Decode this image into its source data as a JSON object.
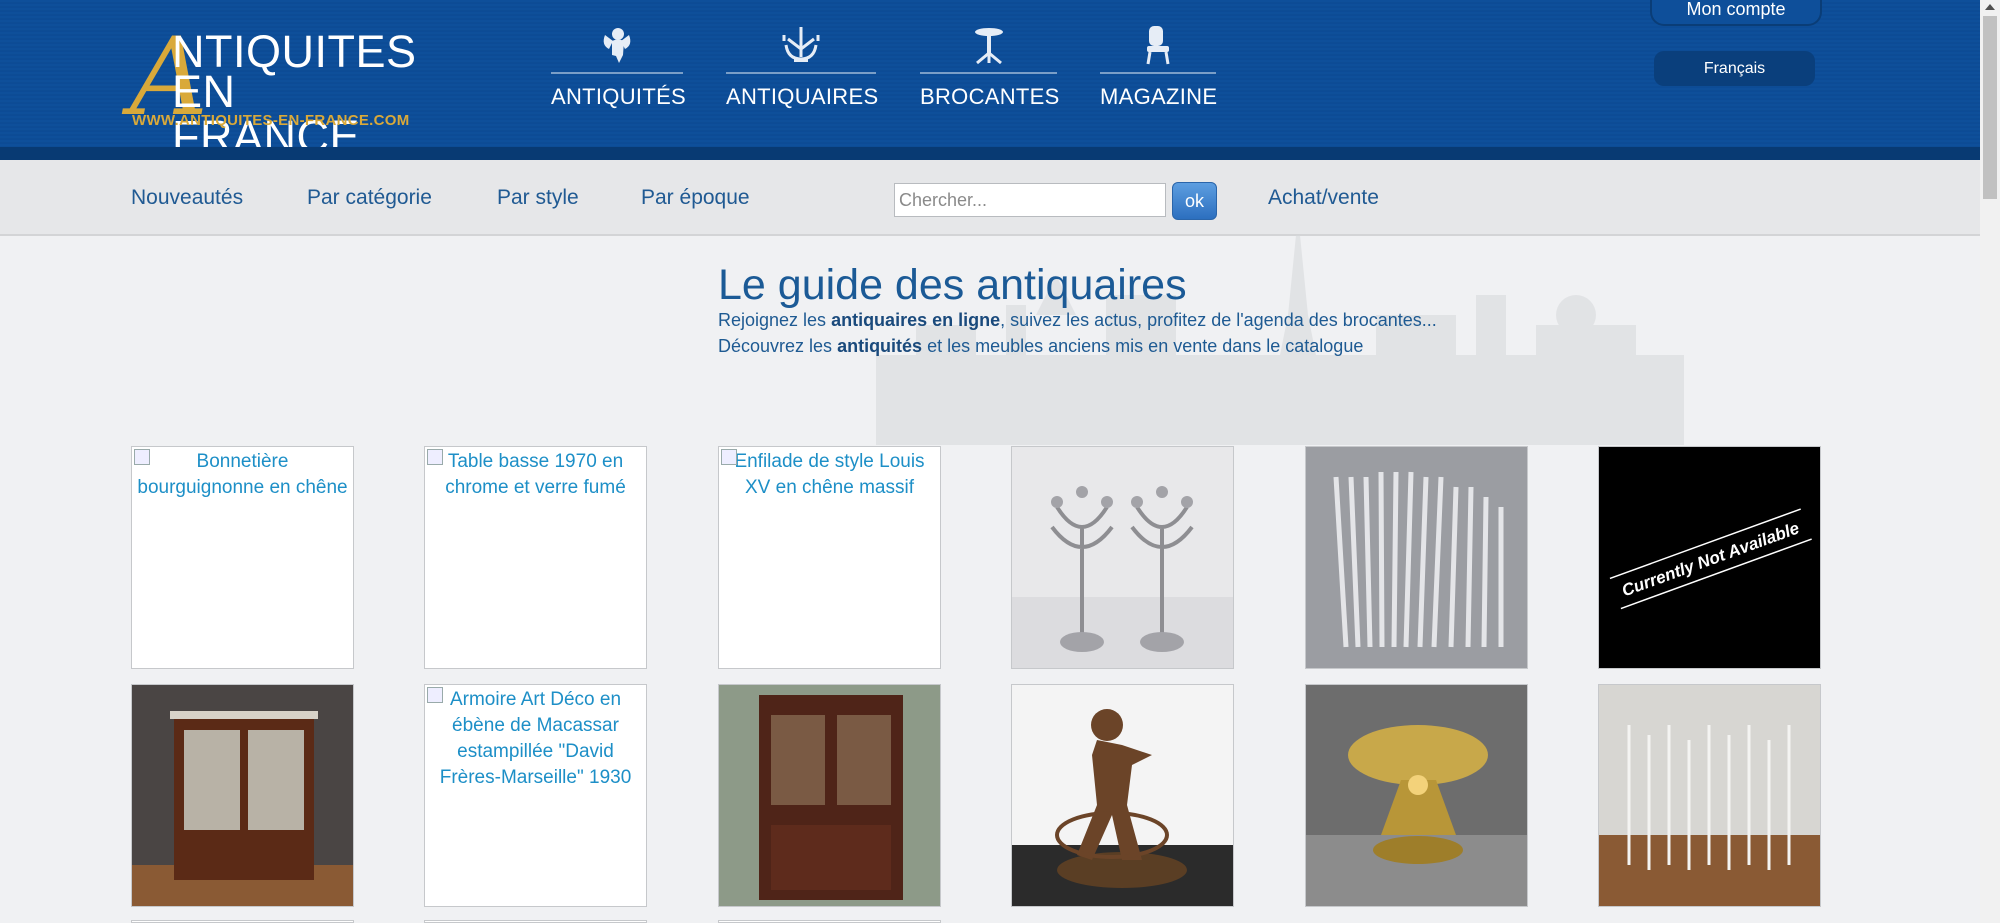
{
  "logo": {
    "line1": "NTIQUITES",
    "line2": "EN FRANCE",
    "big_letter": "A",
    "url": "WWW.ANTIQUITES-EN-FRANCE.COM"
  },
  "main_nav": [
    {
      "label": "ANTIQUITÉS",
      "icon": "cherub-icon"
    },
    {
      "label": "ANTIQUAIRES",
      "icon": "candelabra-icon"
    },
    {
      "label": "BROCANTES",
      "icon": "table-icon"
    },
    {
      "label": "MAGAZINE",
      "icon": "chair-icon"
    }
  ],
  "account": {
    "label": "Mon compte"
  },
  "language": {
    "label": "Français"
  },
  "subnav": {
    "items": [
      "Nouveautés",
      "Par catégorie",
      "Par style",
      "Par époque"
    ],
    "search_placeholder": "Chercher...",
    "search_button": "ok",
    "achat": "Achat/vente"
  },
  "intro": {
    "title": "Le guide des antiquaires",
    "line1_pre": "Rejoignez les ",
    "line1_bold": "antiquaires en ligne",
    "line1_post": ", suivez les actus, profitez de l'agenda des brocantes...",
    "line2_pre": "Découvrez les ",
    "line2_bold": "antiquités",
    "line2_post": " et les meubles anciens mis en vente dans le catalogue"
  },
  "products": [
    {
      "alt": "Bonnetière bourguignonne en chêne",
      "broken": true
    },
    {
      "alt": "Table basse 1970 en chrome et verre fumé",
      "broken": true
    },
    {
      "alt": "Enfilade de style Louis XV en chêne massif",
      "broken": true
    },
    {
      "alt": "Paire de candélabres en argent",
      "broken": false,
      "picture": "candelabra-photo"
    },
    {
      "alt": "Ménagère en argent",
      "broken": false,
      "picture": "cutlery-photo"
    },
    {
      "alt": "Currently Not Available",
      "broken": false,
      "picture": "not-available-photo"
    },
    {
      "alt": "Vitrine en acajou",
      "broken": false,
      "picture": "vitrine-photo"
    },
    {
      "alt": "Armoire Art Déco en ébène de Macassar estampillée \"David Frères-Marseille\" 1930",
      "broken": true
    },
    {
      "alt": "Bibliothèque en acajou",
      "broken": false,
      "picture": "bookcase-photo"
    },
    {
      "alt": "Bronze enfant au cerceau",
      "broken": false,
      "picture": "bronze-photo"
    },
    {
      "alt": "Lampe en bronze doré",
      "broken": false,
      "picture": "lamp-photo"
    },
    {
      "alt": "Flûtes à champagne en cristal",
      "broken": false,
      "picture": "glasses-photo"
    }
  ],
  "not_available_text": "Currently Not Available"
}
